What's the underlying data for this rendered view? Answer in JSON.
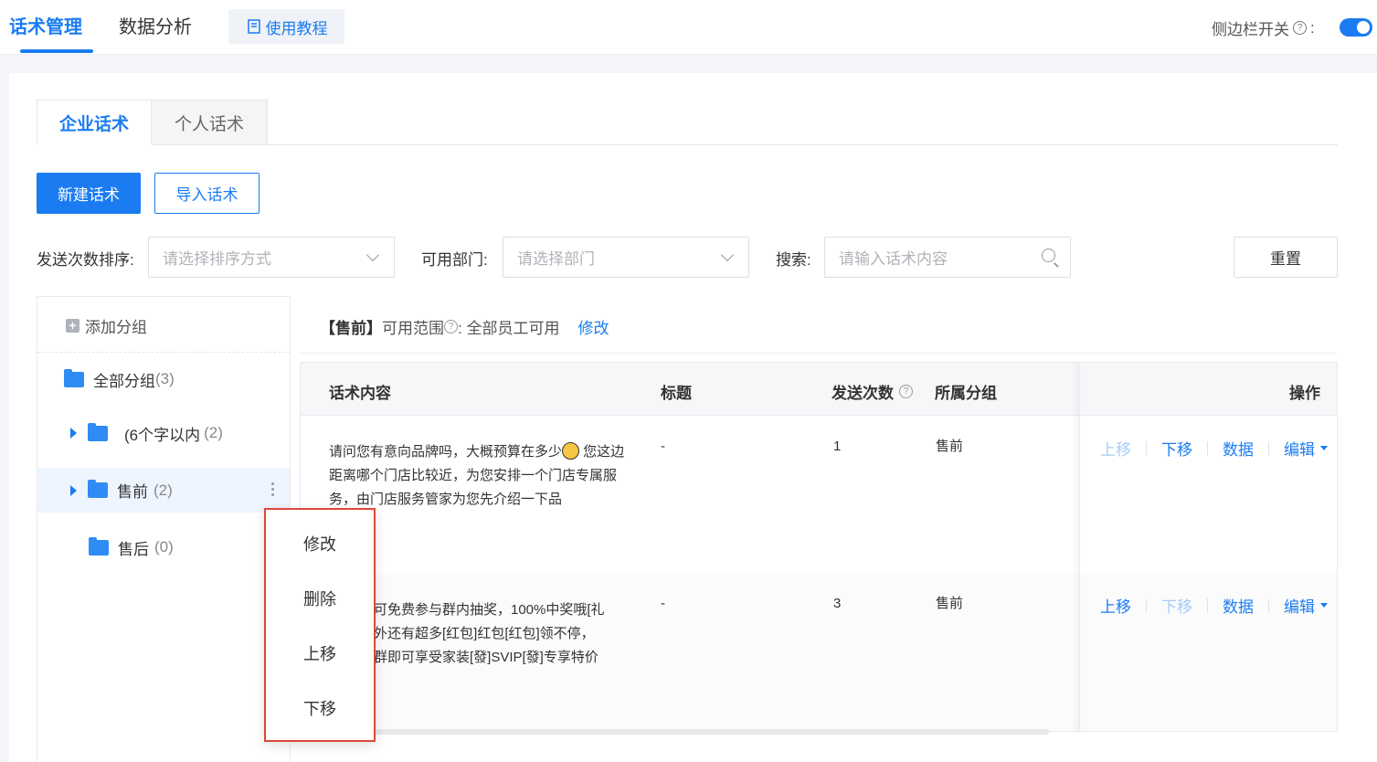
{
  "header": {
    "tabs": [
      {
        "label": "话术管理",
        "active": true
      },
      {
        "label": "数据分析",
        "active": false
      }
    ],
    "tutorial_label": "使用教程",
    "sidebar_switch_label": "侧边栏开关",
    "sidebar_switch_help": "?",
    "sidebar_switch_colon": ":",
    "sidebar_switch_on": true
  },
  "subtabs": [
    {
      "label": "企业话术",
      "active": true
    },
    {
      "label": "个人话术",
      "active": false
    }
  ],
  "actions": {
    "new_label": "新建话术",
    "import_label": "导入话术"
  },
  "filters": {
    "sort_label": "发送次数排序:",
    "sort_placeholder": "请选择排序方式",
    "dept_label": "可用部门:",
    "dept_placeholder": "请选择部门",
    "search_label": "搜索:",
    "search_placeholder": "请输入话术内容",
    "reset_label": "重置"
  },
  "groups": {
    "add_label": "添加分组",
    "all": {
      "name": "全部分组",
      "count": "(3)"
    },
    "items": [
      {
        "name": "(6个字以内",
        "count": "(2)",
        "expandable": true
      },
      {
        "name": "售前",
        "count": "(2)",
        "expandable": true,
        "selected": true
      },
      {
        "name": "售后",
        "count": "(0)",
        "expandable": false
      }
    ]
  },
  "scope": {
    "group_tag": "【售前】",
    "label": "可用范围",
    "help": "?",
    "value": ": 全部员工可用",
    "edit_label": "修改"
  },
  "table": {
    "columns": [
      "话术内容",
      "标题",
      "发送次数",
      "所属分组",
      "操作"
    ],
    "send_count_help": "?",
    "rows": [
      {
        "content_a": "请问您有意向品牌吗，大概预算在多少",
        "content_b": " 您这边距离哪个门店比较近，为您安排一个门店专属服务，由门店服务管家为您先介绍一下品",
        "title": "-",
        "send_count": "1",
        "group": "售前",
        "ops": {
          "up": "上移",
          "down": "下移",
          "data": "数据",
          "edit": "编辑",
          "up_disabled": true,
          "down_disabled": false
        }
      },
      {
        "content_a": "可免费参与群内抽奖，100%中奖哦[礼",
        "content_b": "外还有超多[红包]红包[红包]领不停，",
        "content_c": "群即可享受家装[發]SVIP[發]专享特价",
        "title": "-",
        "send_count": "3",
        "group": "售前",
        "ops": {
          "up": "上移",
          "down": "下移",
          "data": "数据",
          "edit": "编辑",
          "up_disabled": false,
          "down_disabled": true
        }
      }
    ]
  },
  "context_menu": {
    "items": [
      "修改",
      "删除",
      "上移",
      "下移"
    ]
  },
  "colors": {
    "accent": "#1a7cf0",
    "highlight_border": "#e0473a"
  }
}
